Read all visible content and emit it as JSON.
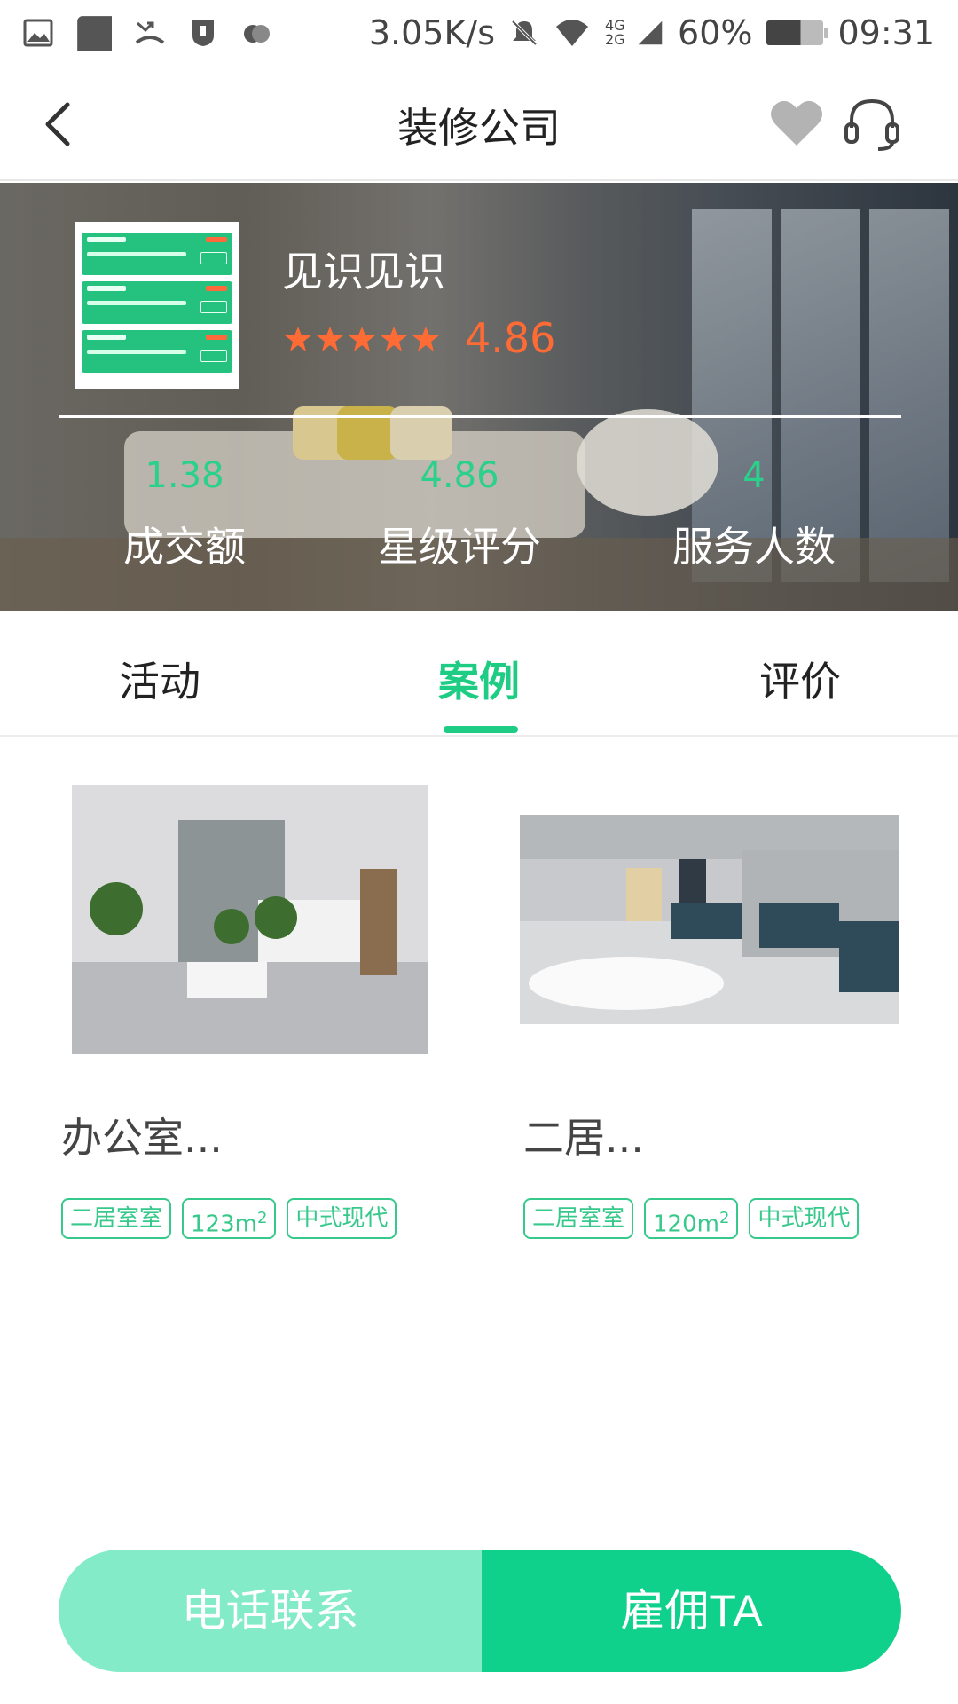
{
  "status_bar": {
    "speed": "3.05K/s",
    "network": "4G 2G",
    "battery": "60%",
    "time": "09:31",
    "battery_level": 0.6,
    "icons": [
      "image-icon",
      "square-app-icon",
      "missed-call-icon",
      "shield-icon",
      "cloud-icon",
      "mute-icon",
      "wifi-icon",
      "signal-icon",
      "battery-icon"
    ]
  },
  "header": {
    "title": "装修公司",
    "icons": [
      "back-arrow-icon",
      "heart-icon",
      "headset-icon"
    ]
  },
  "company": {
    "name": "见识见识",
    "rating": "4.86",
    "stars": 5,
    "stats": [
      {
        "value": "1.38",
        "label": "成交额"
      },
      {
        "value": "4.86",
        "label": "星级评分"
      },
      {
        "value": "4",
        "label": "服务人数"
      }
    ]
  },
  "tabs": [
    {
      "label": "活动",
      "active": false
    },
    {
      "label": "案例",
      "active": true
    },
    {
      "label": "评价",
      "active": false
    }
  ],
  "cases": [
    {
      "title": "办公室...",
      "tags": [
        "二居室室",
        "123m",
        "中式现代"
      ],
      "area_sup": "2"
    },
    {
      "title": "二居...",
      "tags": [
        "二居室室",
        "120m",
        "中式现代"
      ],
      "area_sup": "2"
    }
  ],
  "actions": {
    "call_label": "电话联系",
    "hire_label": "雇佣TA"
  },
  "colors": {
    "accent_green": "#1fcc84",
    "rating_orange": "#ff6b35",
    "call_button": "#84ebc9",
    "hire_button": "#0fd18b"
  }
}
